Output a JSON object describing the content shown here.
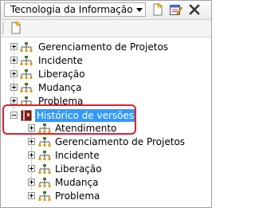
{
  "header": {
    "category_selected": "Tecnologia da Informação",
    "new_icon": "new-document-icon",
    "edit_icon": "edit-form-icon",
    "close_icon": "close-x-icon"
  },
  "toolbar": {
    "new_icon": "new-document-icon"
  },
  "tree": {
    "root_items": [
      {
        "label": "Gerenciamento de Projetos",
        "icon": "hierarchy-icon"
      },
      {
        "label": "Incidente",
        "icon": "hierarchy-icon"
      },
      {
        "label": "Liberação",
        "icon": "hierarchy-icon"
      },
      {
        "label": "Mudança",
        "icon": "hierarchy-icon"
      },
      {
        "label": "Problema",
        "icon": "hierarchy-icon"
      }
    ],
    "history": {
      "label": "Histórico de versões",
      "icon": "book-history-icon",
      "children": [
        {
          "label": "Atendimento",
          "icon": "hierarchy-icon"
        },
        {
          "label": "Gerenciamento de Projetos",
          "icon": "hierarchy-icon"
        },
        {
          "label": "Incidente",
          "icon": "hierarchy-icon"
        },
        {
          "label": "Liberação",
          "icon": "hierarchy-icon"
        },
        {
          "label": "Mudança",
          "icon": "hierarchy-icon"
        },
        {
          "label": "Problema",
          "icon": "hierarchy-icon"
        }
      ]
    }
  },
  "colors": {
    "selection": "#3399ff",
    "highlight_box": "#e0202a"
  }
}
